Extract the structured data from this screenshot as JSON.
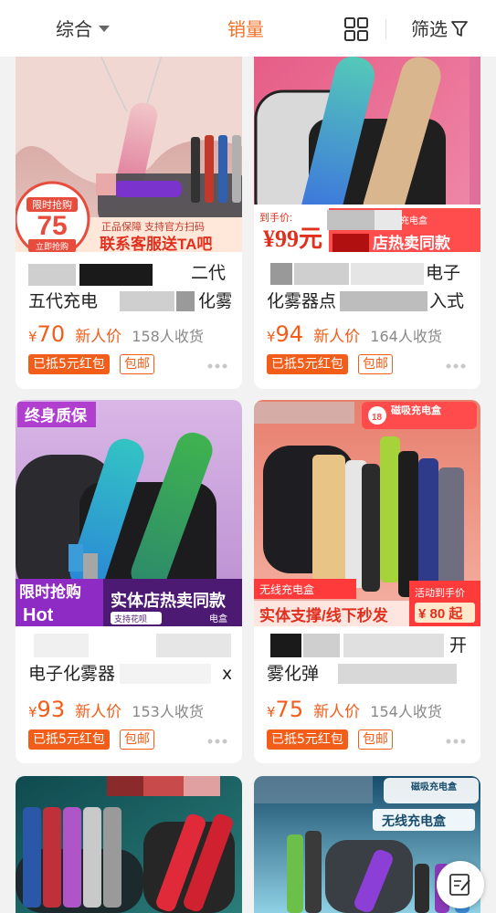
{
  "sort_bar": {
    "comprehensive": "综合",
    "sales": "销量",
    "filter": "筛选",
    "active": "sales",
    "accent_color": "#f07126"
  },
  "products": [
    {
      "title_line1": "二代",
      "title_line2": "五代充电",
      "title_line2b": "化雾",
      "price_symbol": "¥",
      "price": "70",
      "new_user_tag": "新人价",
      "sold": "158人收货",
      "coupon": "已抵5元红包",
      "shipping": "包邮",
      "image": {
        "badge_top": "限时抢购",
        "badge_number": "75",
        "badge_bottom": "立即抢购",
        "guarantee": "正品保障 支持官方扫码",
        "banner": "联系客服送TA吧"
      }
    },
    {
      "title_line1": "电子",
      "title_line2": "化雾器点",
      "title_line2b": "入式",
      "price_symbol": "¥",
      "price": "94",
      "new_user_tag": "新人价",
      "sold": "164人收货",
      "coupon": "已抵5元红包",
      "shipping": "包邮",
      "image": {
        "price_label": "到手价:",
        "price": "¥99元",
        "tag": "充电盒",
        "banner": "店热卖同款"
      }
    },
    {
      "title_line1": "",
      "title_line2": "电子化雾器",
      "title_line2b": "x",
      "price_symbol": "¥",
      "price": "93",
      "new_user_tag": "新人价",
      "sold": "153人收货",
      "coupon": "已抵5元红包",
      "shipping": "包邮",
      "image": {
        "badge_top": "终身质保",
        "flash": "限时抢购",
        "hot": "Hot",
        "banner": "实体店热卖同款",
        "sub_banner": "支持花呗",
        "tag": "电盒"
      }
    },
    {
      "title_line1": "开",
      "title_line2": "雾化弹",
      "title_line2b": "",
      "price_symbol": "¥",
      "price": "75",
      "new_user_tag": "新人价",
      "sold": "154人收货",
      "coupon": "已抵5元红包",
      "shipping": "包邮",
      "image": {
        "top_tag": "磁吸充电盒",
        "age_badge": "18",
        "wireless": "无线充电盒",
        "banner": "实体支撑/线下秒发",
        "promo": "活动到手价",
        "promo_price": "¥ 80 起"
      }
    },
    {
      "image": {}
    },
    {
      "image": {
        "top_tag": "磁吸充电盒",
        "wireless": "无线充电盒"
      }
    }
  ]
}
